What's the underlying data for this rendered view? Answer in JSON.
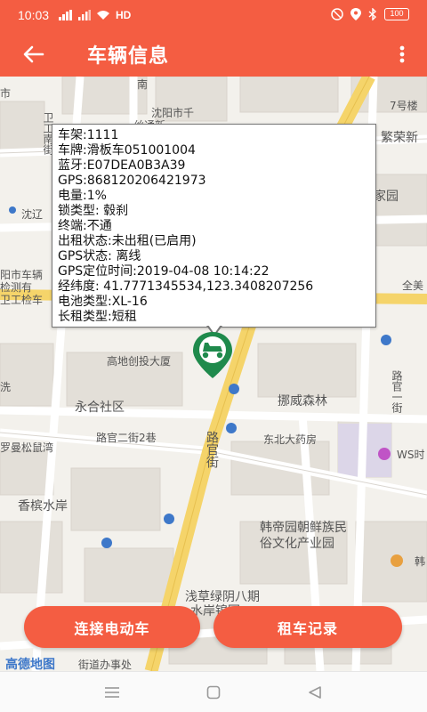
{
  "status_bar": {
    "time": "10:03",
    "network": "HD",
    "battery": "100"
  },
  "app_bar": {
    "title": "车辆信息"
  },
  "map": {
    "labels": {
      "shi_top": "市",
      "nan_vert": "南",
      "shenyang_shi": "沈阳市千",
      "shenyang_shi_2": "丝通新",
      "qi_hao_lou": "7号楼",
      "weigong_nan": "卫工南街",
      "fanrong_xin": "繁荣新",
      "jia_yuan": "家园",
      "shen_liao": "沈辽",
      "yang_shi_che": "阳市车辆",
      "jiance": "检测有",
      "gong_jian": "卫工检车",
      "quan_mei": "全美",
      "gaodi_chuangtou": "高地创投大厦",
      "xi": "洗",
      "nuowei_senlin": "挪威森林",
      "yonghe_shequ": "永合社区",
      "luguan_er": "路官二街2巷",
      "luguan_jie": "路官一街",
      "dongbei_yaofang": "东北大药房",
      "ws_shi": "WS时",
      "luoman_songshuwan": "罗曼松鼠湾",
      "lu_guan_vert": "路官街",
      "xiangbin_shuian": "香槟水岸",
      "handiyuan": "韩帝园朝鲜族民",
      "su_wenhua": "俗文化产业园",
      "han_right": "韩",
      "qiancao_lvyin": "浅草绿阴八期",
      "shuian_jiayuan": "水岸锦园",
      "jiedao_banshichu": "街道办事处",
      "amap_logo": "高德地图"
    }
  },
  "vehicle_info": {
    "lines": [
      "车架:1111",
      "车牌:滑板车051001004",
      "蓝牙:E07DEA0B3A39",
      "GPS:868120206421973",
      "电量:1%",
      "锁类型: 毂刹",
      "终端:不通",
      "出租状态:未出租(已启用)",
      "GPS状态: 离线",
      "GPS定位时间:2019-04-08 10:14:22",
      "经纬度: 41.7771345534,123.3408207256",
      "电池类型:XL-16",
      "长租类型:短租"
    ]
  },
  "actions": {
    "connect_label": "连接电动车",
    "rental_label": "租车记录"
  },
  "colors": {
    "brand": "#f45d42",
    "marker": "#1f8a4c",
    "road_major": "#f5d46a",
    "block": "#e3dfd8"
  }
}
